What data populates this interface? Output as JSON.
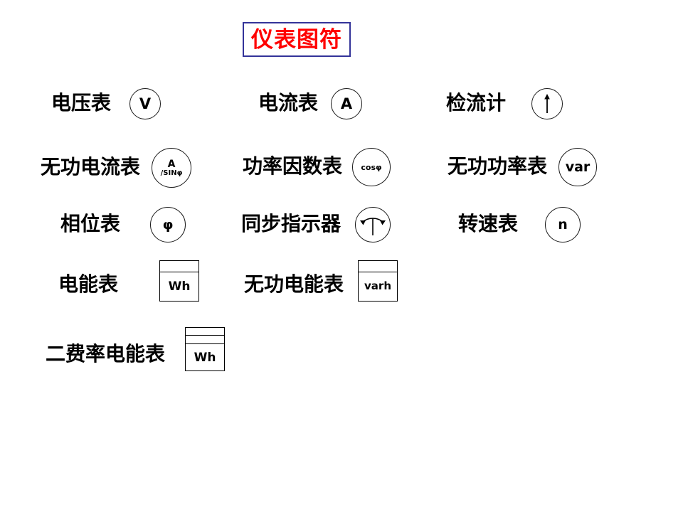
{
  "slide": {
    "title": "仪表图符",
    "title_color": "#ff0000",
    "title_border_color": "#333399",
    "background_color": "#ffffff"
  },
  "symbols": [
    {
      "id": "voltmeter",
      "label": "电压表",
      "symbol_kind": "circle",
      "glyph": "V",
      "glyph2": ""
    },
    {
      "id": "ammeter",
      "label": "电流表",
      "symbol_kind": "circle",
      "glyph": "A",
      "glyph2": ""
    },
    {
      "id": "galvanometer",
      "label": "检流计",
      "symbol_kind": "circle-arrow-up",
      "glyph": "",
      "glyph2": ""
    },
    {
      "id": "reactive-current-meter",
      "label": "无功电流表",
      "symbol_kind": "circle-stacked",
      "glyph": "A",
      "glyph2": "/SINφ"
    },
    {
      "id": "power-factor-meter",
      "label": "功率因数表",
      "symbol_kind": "circle",
      "glyph": "cosφ",
      "glyph2": ""
    },
    {
      "id": "reactive-power-meter",
      "label": "无功功率表",
      "symbol_kind": "circle",
      "glyph": "var",
      "glyph2": ""
    },
    {
      "id": "phase-meter",
      "label": "相位表",
      "symbol_kind": "circle",
      "glyph": "φ",
      "glyph2": ""
    },
    {
      "id": "synchroscope",
      "label": "同步指示器",
      "symbol_kind": "circle-double-arrow",
      "glyph": "",
      "glyph2": ""
    },
    {
      "id": "tachometer",
      "label": "转速表",
      "symbol_kind": "circle",
      "glyph": "n",
      "glyph2": ""
    },
    {
      "id": "watt-hour-meter",
      "label": "电能表",
      "symbol_kind": "rect-1",
      "glyph": "Wh",
      "glyph2": ""
    },
    {
      "id": "reactive-energy-meter",
      "label": "无功电能表",
      "symbol_kind": "rect-1",
      "glyph": "varh",
      "glyph2": ""
    },
    {
      "id": "two-tariff-energy-meter",
      "label": "二费率电能表",
      "symbol_kind": "rect-2",
      "glyph": "Wh",
      "glyph2": ""
    }
  ]
}
